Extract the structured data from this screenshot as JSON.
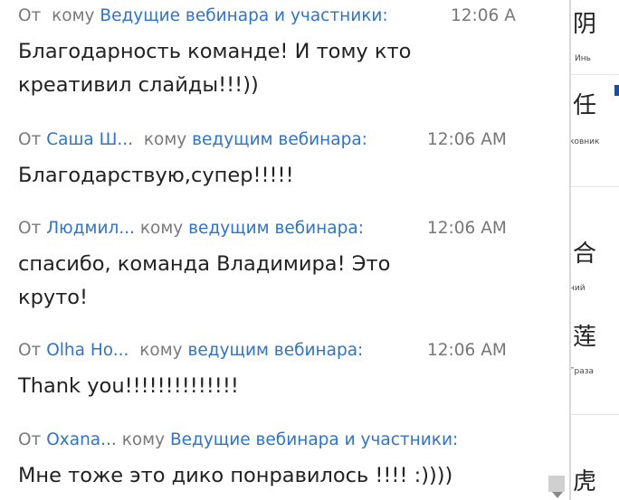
{
  "chat": {
    "messages": [
      {
        "from_label": "От",
        "sender": "",
        "to_label": "кому",
        "recipient": "Ведущие вебинара и участники:",
        "time": "12:06 A",
        "text": "Благодарность команде! И тому кто креативил слайды!!!))"
      },
      {
        "from_label": "От",
        "sender": "Саша Ш...",
        "to_label": "кому",
        "recipient": "ведущим вебинара:",
        "time": "12:06 AM",
        "text": "Благодарствую,супер!!!!!"
      },
      {
        "from_label": "От",
        "sender": "Людмил...",
        "to_label": "кому",
        "recipient": "ведущим вебинара:",
        "time": "12:06 AM",
        "text": "спасибо, команда Владимира! Это круто!"
      },
      {
        "from_label": "От",
        "sender": "Olha Ho...",
        "to_label": "кому",
        "recipient": "ведущим вебинара:",
        "time": "12:06 AM",
        "text": "Thank you!!!!!!!!!!!!!!"
      },
      {
        "from_label": "От",
        "sender": "Oxana...",
        "to_label": "кому",
        "recipient": "Ведущие вебинара и участники:",
        "time": "",
        "text": "Мне тоже это дико понравилось !!!! :))))"
      }
    ]
  },
  "side_panel": {
    "items": [
      {
        "glyph": "阴",
        "caption": "Инь"
      },
      {
        "glyph": "任",
        "caption": "ковник"
      },
      {
        "glyph": "合",
        "caption": "ний"
      },
      {
        "glyph": "莲",
        "caption": "Граза"
      },
      {
        "glyph": "虎",
        "caption": ""
      }
    ]
  },
  "colors": {
    "link_blue": "#2f74c9",
    "meta_gray": "#777777",
    "text": "#222222"
  }
}
